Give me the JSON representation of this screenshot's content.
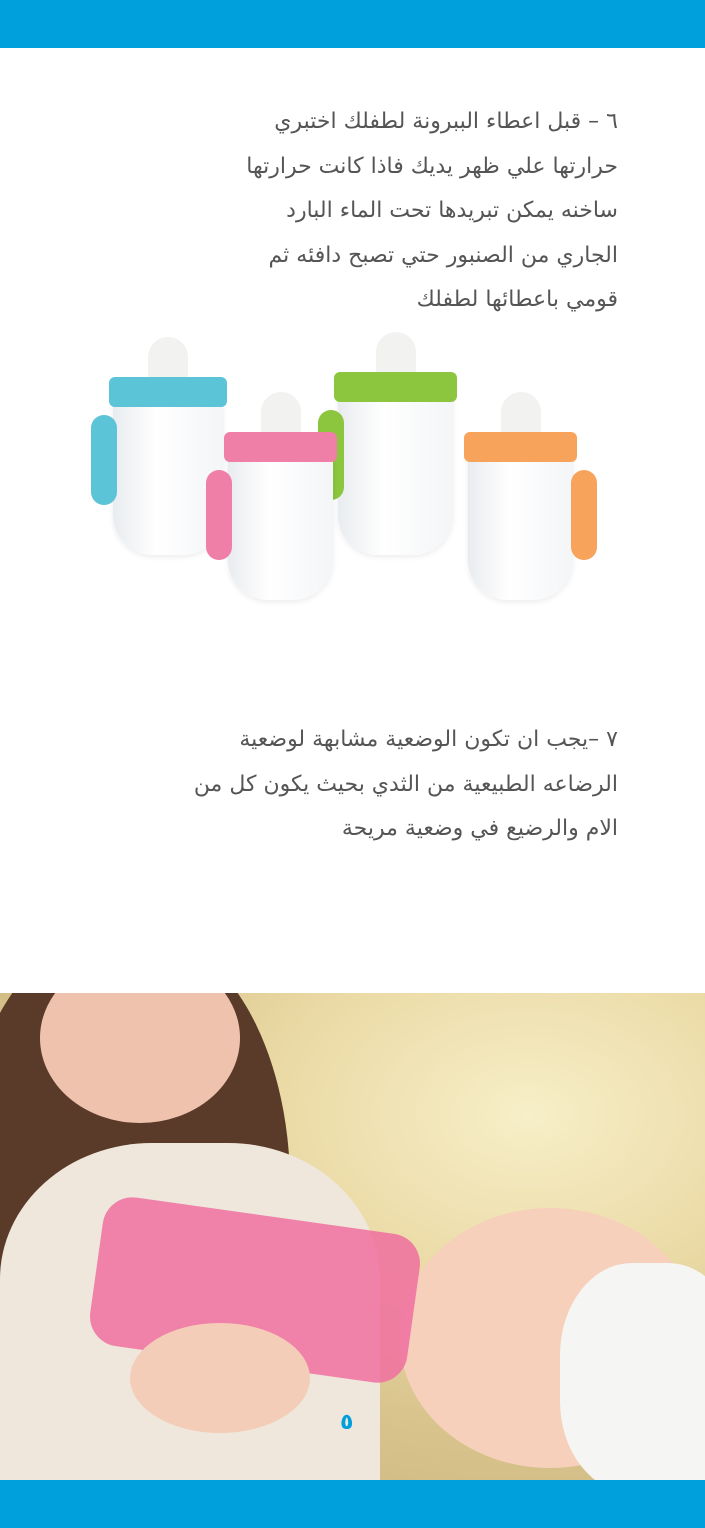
{
  "colors": {
    "accent": "#00a0dc",
    "text": "#555555"
  },
  "section6": {
    "lines": [
      "٦ – قبل اعطاء الببرونة لطفلك اختبري",
      "حرارتها علي ظهر يديك فاذا كانت حرارتها",
      "ساخنه يمكن تبريدها تحت الماء البارد",
      "الجاري من الصنبور حتي تصبح دافئه ثم",
      "قومي باعطائها لطفلك"
    ]
  },
  "cups": {
    "colors": [
      "#5bc4d6",
      "#f07fa8",
      "#8cc63f",
      "#f7a35c"
    ]
  },
  "section7": {
    "lines": [
      "٧ –يجب ان تكون الوضعية مشابهة لوضعية",
      "الرضاعه الطبيعية من الثدي بحيث يكون كل من",
      "الام والرضيع في وضعية مريحة"
    ]
  },
  "page_number": "٥"
}
